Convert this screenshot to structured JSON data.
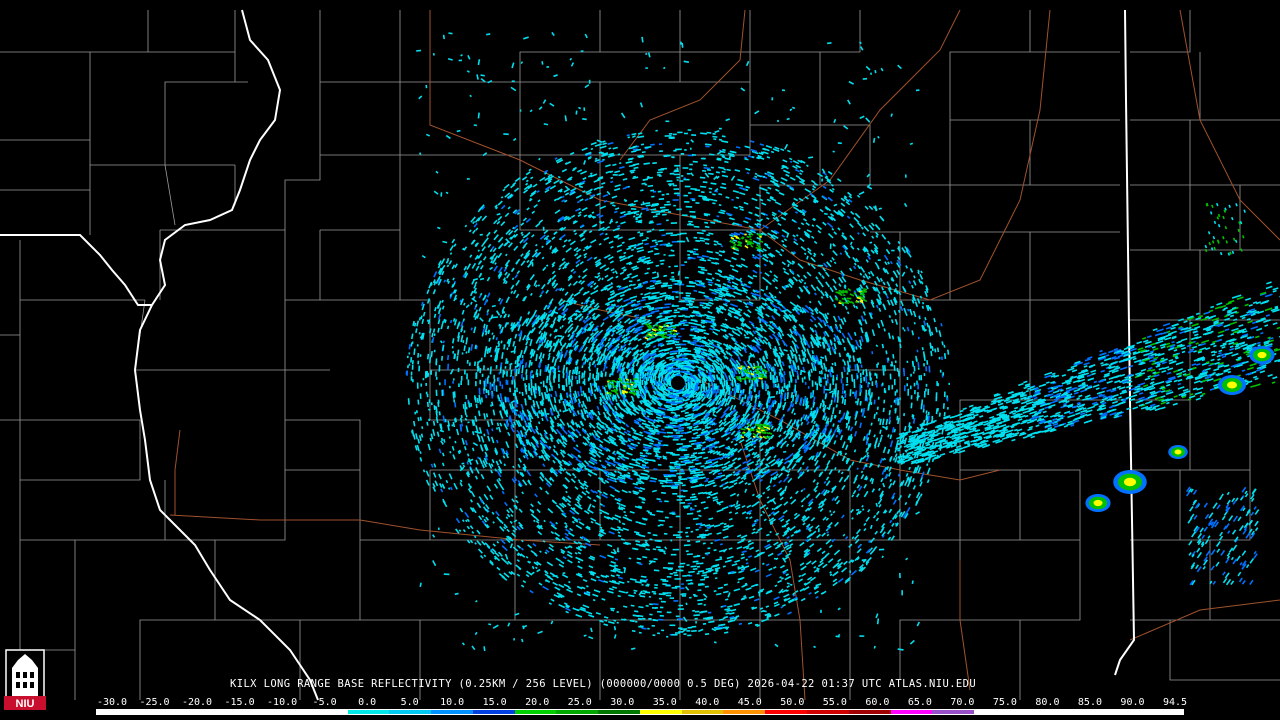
{
  "product": {
    "title": "KILX LONG RANGE BASE REFLECTIVITY (0.25KM / 256 LEVEL) (000000/0000 0.5 DEG) 2026-04-22 01:37 UTC  ATLAS.NIU.EDU"
  },
  "logo": {
    "text": "NIU"
  },
  "scale": {
    "labels": [
      "-30.0",
      "-25.0",
      "-20.0",
      "-15.0",
      "-10.0",
      "-5.0",
      "0.0",
      "5.0",
      "10.0",
      "15.0",
      "20.0",
      "25.0",
      "30.0",
      "35.0",
      "40.0",
      "45.0",
      "50.0",
      "55.0",
      "60.0",
      "65.0",
      "70.0",
      "75.0",
      "80.0",
      "85.0",
      "90.0",
      "94.5"
    ],
    "colors": [
      "#ffffff",
      "#ffffff",
      "#ffffff",
      "#ffffff",
      "#ffffff",
      "#ffffff",
      "#00e8e8",
      "#00c8f0",
      "#0090ff",
      "#0040e0",
      "#00d000",
      "#00a800",
      "#007800",
      "#ffff00",
      "#e0c000",
      "#ff9000",
      "#ff0000",
      "#d00000",
      "#a00000",
      "#ff00ff",
      "#9850c8",
      "#ffffff",
      "#ffffff",
      "#ffffff",
      "#ffffff",
      "#ffffff"
    ]
  },
  "colors": {
    "background": "#000000",
    "county_lines": "#9a9a9a",
    "state_lines": "#ffffff",
    "highways": "#a0522d",
    "echo_light": "#00e0f0",
    "echo_medium": "#0070ff",
    "echo_green": "#00c000",
    "echo_yellow": "#ffff00"
  }
}
